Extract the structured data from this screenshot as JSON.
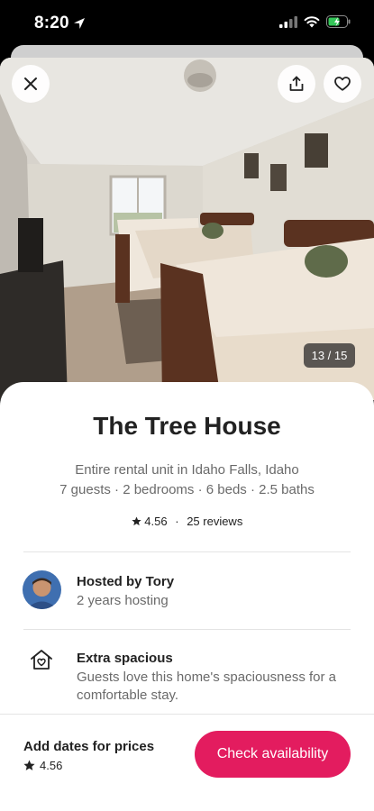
{
  "status": {
    "time": "8:20"
  },
  "gallery": {
    "counter": "13 / 15"
  },
  "listing": {
    "title": "The Tree House",
    "type_location": "Entire rental unit in Idaho Falls, Idaho",
    "details": "7 guests · 2 bedrooms · 6 beds · 2.5 baths",
    "rating": "4.56",
    "separator": "·",
    "reviews": "25 reviews"
  },
  "host": {
    "name": "Hosted by Tory",
    "years": "2 years hosting"
  },
  "highlight": {
    "icon": "home-heart-icon",
    "title": "Extra spacious",
    "description": "Guests love this home's spaciousness for a comfortable stay."
  },
  "footer": {
    "label": "Add dates for prices",
    "rating": "4.56",
    "cta_label": "Check availability"
  },
  "colors": {
    "brand": "#e31c5f",
    "text": "#222222",
    "muted": "#6a6a6a"
  }
}
